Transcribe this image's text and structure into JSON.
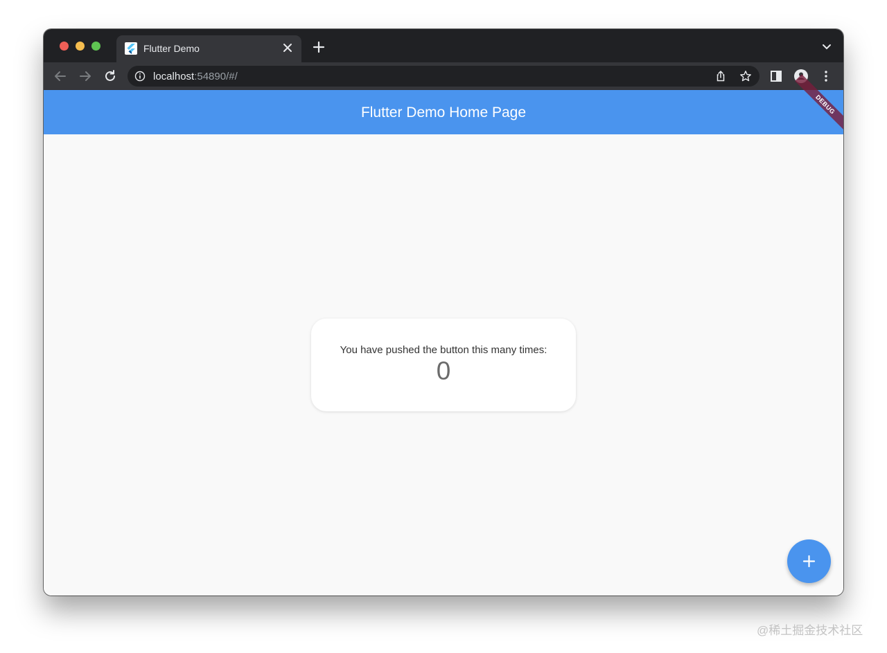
{
  "browser": {
    "tab_title": "Flutter Demo",
    "url_host": "localhost",
    "url_rest": ":54890/#/"
  },
  "app": {
    "title": "Flutter Demo Home Page",
    "debug_label": "DEBUG",
    "message": "You have pushed the button this many times:",
    "counter": "0",
    "accent_color": "#4a94ee"
  },
  "watermark": "@稀土掘金技术社区",
  "icons": [
    "close-icon",
    "plus-icon",
    "chevron-down-icon",
    "back-icon",
    "forward-icon",
    "reload-icon",
    "info-icon",
    "share-icon",
    "star-icon",
    "sidepanel-icon",
    "profile-icon",
    "menu-icon",
    "flutter-logo-icon"
  ]
}
